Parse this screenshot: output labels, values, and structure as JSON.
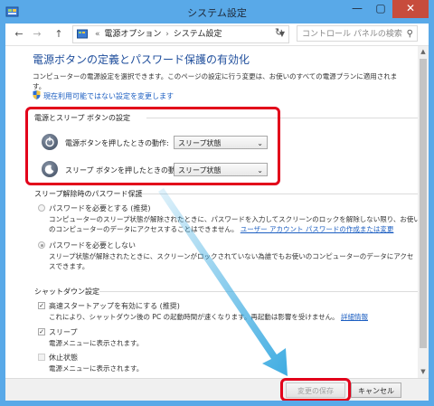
{
  "window": {
    "title": "システム設定",
    "controls": {
      "minimize": "—",
      "maximize": "▢",
      "close": "✕"
    }
  },
  "nav": {
    "back": "←",
    "forward": "→",
    "up": "↑",
    "breadcrumb": [
      "電源オプション",
      "システム設定"
    ],
    "breadcrumb_prefix": "«",
    "breadcrumb_sep": "›",
    "search_placeholder": "コントロール パネルの検索"
  },
  "page": {
    "title": "電源ボタンの定義とパスワード保護の有効化",
    "description_line1": "コンピューターの電源設定を選択できます。このページの設定に行う変更は、お使いのすべての電源プランに適用されま",
    "description_line2": "す。",
    "admin_link": "現在利用可能ではない設定を変更します"
  },
  "power_buttons": {
    "header": "電源とスリープ ボタンの設定",
    "power_label": "電源ボタンを押したときの動作:",
    "power_value": "スリープ状態",
    "sleep_label": "スリープ ボタンを押したときの動作:",
    "sleep_value": "スリープ状態"
  },
  "password": {
    "header": "スリープ解除時のパスワード保護",
    "require_label": "パスワードを必要とする (推奨)",
    "require_desc1": "コンピューターのスリープ状態が解除されたときに、パスワードを入力してスクリーンのロックを解除しない限り、お使い",
    "require_desc2": "のコンピューターのデータにアクセスすることはできません。",
    "require_link": "ユーザー アカウント パスワードの作成または変更",
    "norequire_label": "パスワードを必要としない",
    "norequire_desc1": "スリープ状態が解除されたときに、スクリーンがロックされていない為誰でもお使いのコンピューターのデータにアクセ",
    "norequire_desc2": "スできます。"
  },
  "shutdown": {
    "header": "シャットダウン設定",
    "fast_label": "高速スタートアップを有効にする (推奨)",
    "fast_desc": "これにより、シャットダウン後の PC の起動時間が速くなります。再起動は影響を受けません。",
    "fast_link": "詳細情報",
    "sleep_label": "スリープ",
    "sleep_desc": "電源メニューに表示されます。",
    "hibernate_label": "休止状態",
    "hibernate_desc": "電源メニューに表示されます。",
    "check_mark": "✓"
  },
  "footer": {
    "save": "変更の保存",
    "cancel": "キャンセル"
  },
  "colors": {
    "titlebar": "#59a9e8",
    "highlight": "#e2001a",
    "link": "#1d5fc2",
    "heading": "#1f4e9c",
    "arrow": "#35a8e0"
  }
}
